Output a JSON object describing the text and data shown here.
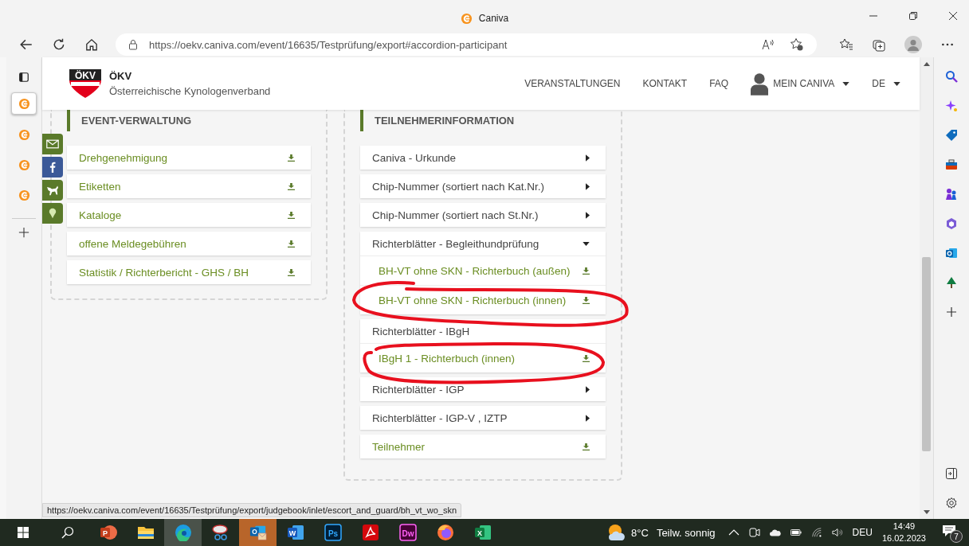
{
  "browser": {
    "title": "Caniva",
    "url": "https://oekv.caniva.com/event/16635/Testprüfung/export#accordion-participant",
    "status_url": "https://oekv.caniva.com/event/16635/Testprüfung/export/judgebook/inlet/escort_and_guard/bh_vt_wo_skn",
    "vertical_tabs": [
      {
        "selected": true
      },
      {
        "selected": false
      },
      {
        "selected": false
      },
      {
        "selected": false
      }
    ]
  },
  "site": {
    "brand": "ÖKV",
    "logo_text": "ÖKV",
    "subtitle": "Österreichische Kynologenverband",
    "nav": [
      {
        "label": "VERANSTALTUNGEN",
        "kind": "link"
      },
      {
        "label": "KONTAKT",
        "kind": "link"
      },
      {
        "label": "FAQ",
        "kind": "link"
      },
      {
        "label": "MEIN CANIVA",
        "kind": "user-menu"
      },
      {
        "label": "DE",
        "kind": "menu"
      }
    ],
    "social": [
      {
        "kind": "mail"
      },
      {
        "kind": "facebook"
      },
      {
        "kind": "dog"
      },
      {
        "kind": "pin"
      }
    ]
  },
  "panels": [
    {
      "title": "EVENT-VERWALTUNG",
      "items": [
        {
          "label": "Drehgenehmigung",
          "kind": "download"
        },
        {
          "label": "Etiketten",
          "kind": "download"
        },
        {
          "label": "Kataloge",
          "kind": "download"
        },
        {
          "label": "offene Meldegebühren",
          "kind": "download"
        },
        {
          "label": "Statistik / Richterbericht - GHS / BH",
          "kind": "download"
        }
      ]
    },
    {
      "title": "TEILNEHMERINFORMATION",
      "items": [
        {
          "label": "Caniva - Urkunde",
          "kind": "submenu",
          "expanded": false
        },
        {
          "label": "Chip-Nummer (sortiert nach Kat.Nr.)",
          "kind": "submenu",
          "expanded": false
        },
        {
          "label": "Chip-Nummer (sortiert nach St.Nr.)",
          "kind": "submenu",
          "expanded": false
        },
        {
          "label": "Richterblätter - Begleithundprüfung",
          "kind": "submenu",
          "expanded": true,
          "children": [
            {
              "label": "BH-VT ohne SKN - Richterbuch (außen)",
              "kind": "download"
            },
            {
              "label": "BH-VT ohne SKN - Richterbuch (innen)",
              "kind": "download"
            }
          ]
        },
        {
          "label": "Richterblätter - IBgH",
          "kind": "section",
          "children": [
            {
              "label": "IBgH 1 - Richterbuch (innen)",
              "kind": "download"
            }
          ]
        },
        {
          "label": "Richterblätter - IGP",
          "kind": "submenu",
          "expanded": false
        },
        {
          "label": "Richterblätter - IGP-V , IZTP",
          "kind": "submenu",
          "expanded": false
        },
        {
          "label": "Teilnehmer",
          "kind": "download"
        }
      ]
    }
  ],
  "taskbar": {
    "apps": [
      {
        "kind": "powerpoint",
        "glyph": "P",
        "active": false,
        "attention": false
      },
      {
        "kind": "explorer",
        "active": false,
        "attention": false
      },
      {
        "kind": "edge",
        "active": true,
        "attention": false
      },
      {
        "kind": "snipping",
        "active": false,
        "attention": false
      },
      {
        "kind": "outlook",
        "glyph": "O",
        "active": false,
        "attention": true
      },
      {
        "kind": "word",
        "glyph": "W",
        "active": false,
        "attention": false
      },
      {
        "kind": "photoshop",
        "glyph": "Ps",
        "active": false,
        "attention": false
      },
      {
        "kind": "acrobat",
        "active": false,
        "attention": false
      },
      {
        "kind": "dreamweaver",
        "glyph": "Dw",
        "active": false,
        "attention": false
      },
      {
        "kind": "firefox",
        "active": false,
        "attention": false
      },
      {
        "kind": "excel",
        "glyph": "X",
        "active": false,
        "attention": false
      }
    ],
    "temperature": "8°C",
    "weather": "Teilw. sonnig",
    "language": "DEU",
    "time": "14:49",
    "date": "16.02.2023",
    "notifications": "7"
  }
}
